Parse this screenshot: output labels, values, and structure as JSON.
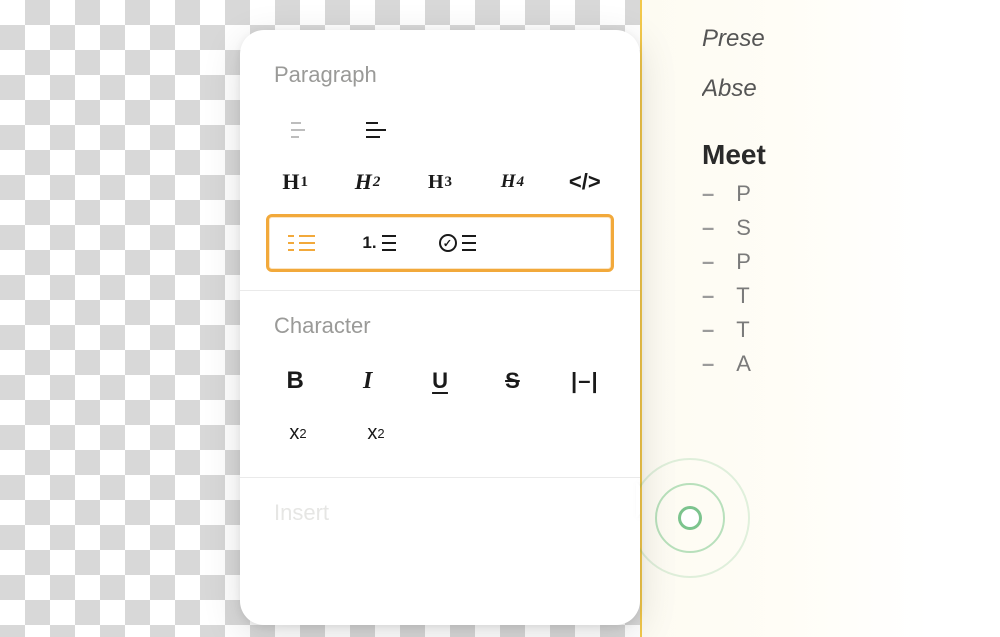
{
  "panel": {
    "sections": {
      "paragraph_label": "Paragraph",
      "character_label": "Character",
      "insert_label": "Insert"
    },
    "headings": {
      "h1": "H",
      "h1s": "1",
      "h2": "H",
      "h2s": "2",
      "h3": "H",
      "h3s": "3",
      "h4": "H",
      "h4s": "4"
    },
    "code_label": "</>",
    "ordered_prefix": "1.",
    "check_glyph": "✓",
    "char": {
      "bold": "B",
      "italic": "I",
      "underline": "U",
      "strike": "S",
      "highlight": "|–|",
      "sup_base": "x",
      "sup_exp": "2",
      "sub_base": "x",
      "sub_exp": "2"
    }
  },
  "doc": {
    "line1": "Prese",
    "line2": "Abse",
    "heading": "Meet",
    "bullets": [
      "P",
      "S",
      "P",
      "T",
      "T",
      "A"
    ]
  },
  "colors": {
    "highlight_border": "#f2a93b",
    "pulse": "#6cbf7f"
  }
}
